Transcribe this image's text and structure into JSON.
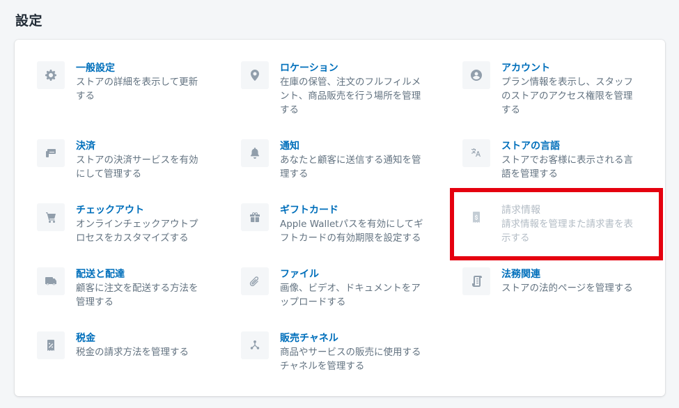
{
  "page": {
    "title": "設定"
  },
  "items": [
    {
      "title": "一般設定",
      "desc": "ストアの詳細を表示して更新\nする",
      "icon": "gear-icon"
    },
    {
      "title": "ロケーション",
      "desc": "在庫の保管、注文のフルフィルメ\nント、商品販売を行う場所を管理\nする",
      "icon": "location-pin-icon"
    },
    {
      "title": "アカウント",
      "desc": "プラン情報を表示し、スタッフ\nのストアのアクセス権限を管理\nする",
      "icon": "user-circle-icon"
    },
    {
      "title": "決済",
      "desc": "ストアの決済サービスを有効\nにして管理する",
      "icon": "payment-card-icon"
    },
    {
      "title": "通知",
      "desc": "あなたと顧客に送信する通知を管\n理する",
      "icon": "bell-icon"
    },
    {
      "title": "ストアの言語",
      "desc": "ストアでお客様に表示される言\n語を管理する",
      "icon": "translate-icon"
    },
    {
      "title": "チェックアウト",
      "desc": "オンラインチェックアウトプ\nロセスをカスタマイズする",
      "icon": "cart-icon"
    },
    {
      "title": "ギフトカード",
      "desc": "Apple Walletパスを有効にしてギ\nフトカードの有効期限を設定する",
      "icon": "gift-icon"
    },
    {
      "title": "請求情報",
      "desc": "請求情報を管理また請求書を表\n示する",
      "icon": "receipt-dollar-icon"
    },
    {
      "title": "配送と配達",
      "desc": "顧客に注文を配送する方法を\n管理する",
      "icon": "truck-icon"
    },
    {
      "title": "ファイル",
      "desc": "画像、ビデオ、ドキュメントをア\nップロードする",
      "icon": "paperclip-icon"
    },
    {
      "title": "法務関連",
      "desc": "ストアの法的ページを管理する",
      "icon": "legal-scroll-icon"
    },
    {
      "title": "税金",
      "desc": "税金の請求方法を管理する",
      "icon": "tax-receipt-icon"
    },
    {
      "title": "販売チャネル",
      "desc": "商品やサービスの販売に使用する\nチャネルを管理する",
      "icon": "channels-icon"
    }
  ],
  "colors": {
    "link": "#006fbb",
    "description": "#637381",
    "icon": "#919eab",
    "highlight": "#e5000f"
  }
}
